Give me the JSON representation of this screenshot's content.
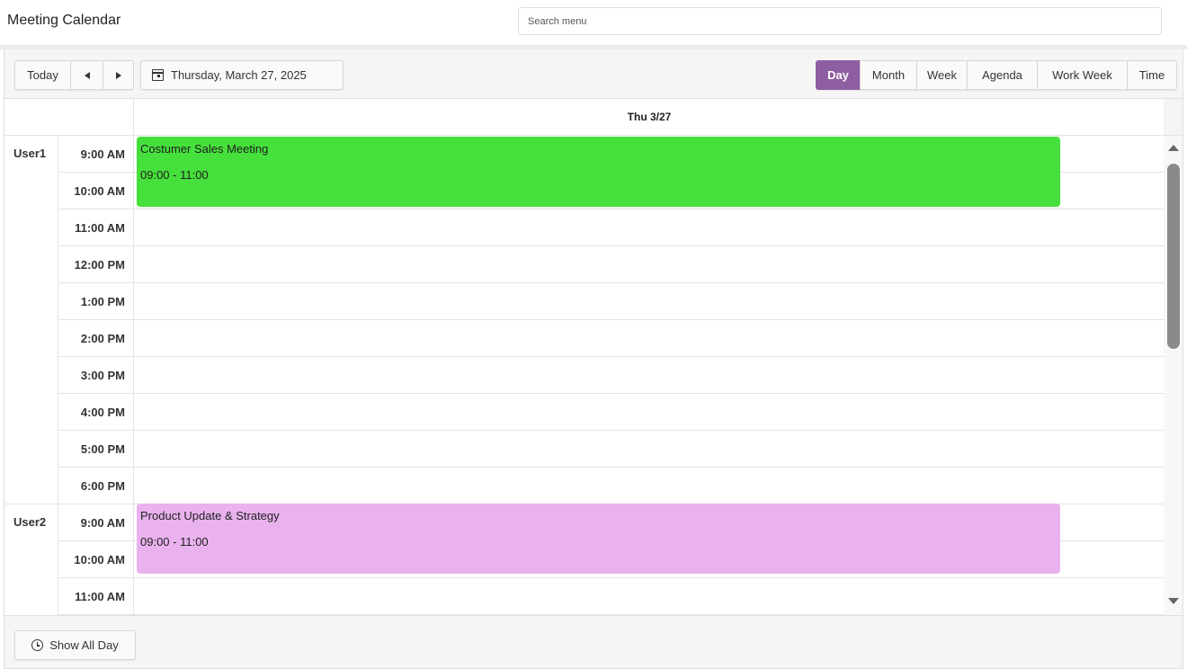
{
  "app": {
    "title": "Meeting Calendar"
  },
  "search": {
    "placeholder": "Search menu"
  },
  "toolbar": {
    "today_label": "Today",
    "current_date_label": "Thursday, March 27, 2025",
    "views": [
      {
        "label": "Day",
        "active": true
      },
      {
        "label": "Month",
        "active": false
      },
      {
        "label": "Week",
        "active": false
      },
      {
        "label": "Agenda",
        "active": false
      },
      {
        "label": "Work Week",
        "active": false
      },
      {
        "label": "Time",
        "active": false
      }
    ]
  },
  "grid": {
    "day_header": "Thu 3/27",
    "resources": [
      {
        "name": "User1",
        "times": [
          "9:00 AM",
          "10:00 AM",
          "11:00 AM",
          "12:00 PM",
          "1:00 PM",
          "2:00 PM",
          "3:00 PM",
          "4:00 PM",
          "5:00 PM",
          "6:00 PM"
        ]
      },
      {
        "name": "User2",
        "times": [
          "9:00 AM",
          "10:00 AM",
          "11:00 AM"
        ]
      }
    ],
    "events": [
      {
        "resource": "User1",
        "title": "Costumer Sales Meeting",
        "time": "09:00 - 11:00",
        "color": "#46e03c"
      },
      {
        "resource": "User2",
        "title": "Product Update & Strategy",
        "time": "09:00 - 11:00",
        "color": "#e9b2ee"
      }
    ]
  },
  "footer": {
    "show_all_day_label": "Show All Day"
  },
  "colors": {
    "accent": "#8e5ea2",
    "event_user1": "#46e03c",
    "event_user2": "#e9b2ee"
  }
}
